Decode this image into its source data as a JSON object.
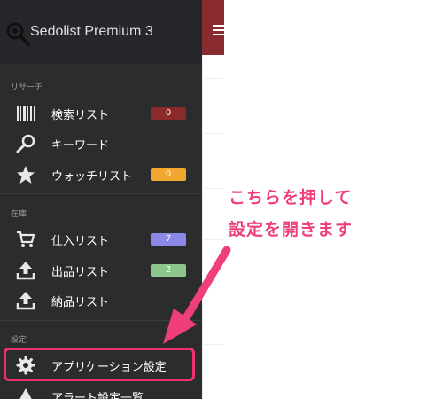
{
  "app": {
    "title": "Sedolist Premium 3"
  },
  "sections": {
    "research": "リサーチ",
    "inventory": "在庫",
    "settings": "設定"
  },
  "items": {
    "search_list": {
      "label": "検索リスト",
      "badge": "0",
      "badge_color": "#8b2a2a"
    },
    "keyword": {
      "label": "キーワード"
    },
    "watch_list": {
      "label": "ウォッチリスト",
      "badge": "0",
      "badge_color": "#f2a72e"
    },
    "purchase_list": {
      "label": "仕入リスト",
      "badge": "7",
      "badge_color": "#8c88e6"
    },
    "listing_list": {
      "label": "出品リスト",
      "badge": "2",
      "badge_color": "#8cc68c"
    },
    "delivery_list": {
      "label": "納品リスト"
    },
    "app_settings": {
      "label": "アプリケーション設定"
    },
    "alert_settings": {
      "label": "アラート設定一覧"
    }
  },
  "annotation": {
    "line1": "こちらを押して",
    "line2": "設定を開きます",
    "color": "#ef3f78"
  },
  "colors": {
    "sidebar_bg": "#2b2c2e",
    "header_strip": "#8a2b30"
  }
}
